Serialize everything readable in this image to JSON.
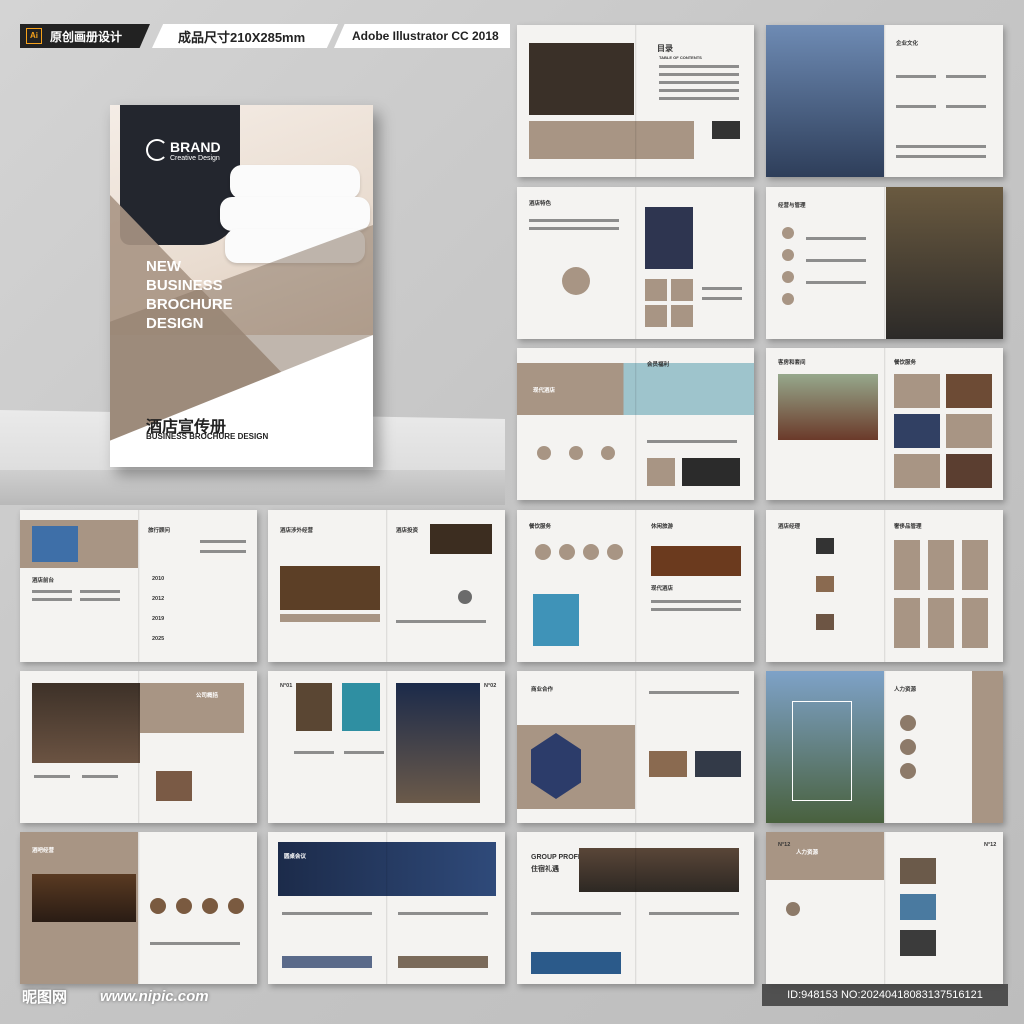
{
  "header": {
    "badge_software": "Ai",
    "badge_title": "原创画册设计",
    "badge_size": "成品尺寸210X285mm",
    "badge_app": "Adobe Illustrator CC 2018"
  },
  "cover": {
    "brand": "BRAND",
    "brand_sub": "Creative Design",
    "title_lines": [
      "NEW",
      "BUSINESS",
      "BROCHURE",
      "DESIGN"
    ],
    "title_cn": "酒店宣传册",
    "title_en": "BUSINESS BROCHURE DESIGN"
  },
  "spread_titles": {
    "toc": "目录",
    "toc_en": "TABLE OF CONTENTS",
    "culture": "企业文化",
    "feature": "酒店特色",
    "manage": "经营与管理",
    "modern": "现代酒店",
    "welfare": "会员福利",
    "room": "客房和套间",
    "dining": "餐饮服务",
    "travel": "旅行顾问",
    "front": "酒店前台",
    "invest": "酒店投资",
    "foreign": "酒店涉外经营",
    "catering": "餐饮服务",
    "leisure": "休闲旅游",
    "manager": "酒店经理",
    "luxury": "奢侈品管理",
    "profile": "公司概括",
    "no01": "N°01",
    "no02": "N°02",
    "biz": "商业合作",
    "hr": "人力资源",
    "bar": "酒吧经营",
    "meeting": "圆桌会议",
    "group": "GROUP PROFILE",
    "group_cn": "住宿礼遇",
    "hr2": "人力资源",
    "no12": "N°12"
  },
  "years": [
    "2010",
    "2012",
    "2019",
    "2025"
  ],
  "colors": {
    "brand_tan": "#a89584",
    "brand_dark": "#8d7a69"
  },
  "footer": {
    "logo": "昵图网",
    "url": "www.nipic.com",
    "id": "ID:948153 NO:20240418083137516121"
  }
}
